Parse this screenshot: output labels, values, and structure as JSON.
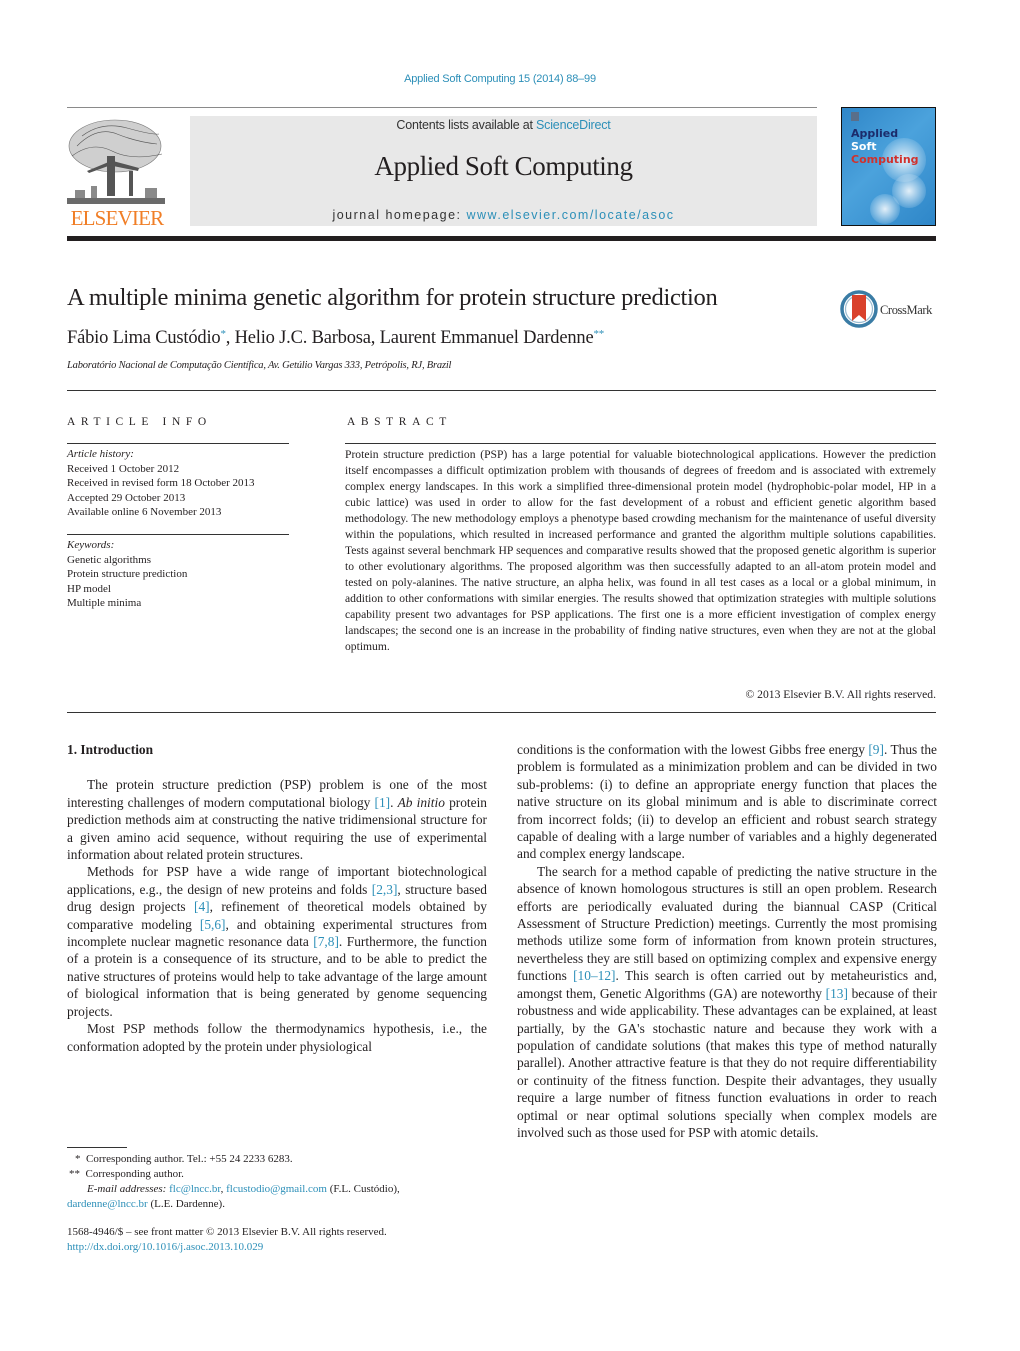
{
  "header": {
    "citation": "Applied Soft Computing 15 (2014) 88–99",
    "contents_prefix": "Contents lists available at ",
    "contents_link": "ScienceDirect",
    "journal_name": "Applied Soft Computing",
    "homepage_prefix": "journal homepage: ",
    "homepage_link": "www.elsevier.com/locate/asoc",
    "publisher_logo_text": "ELSEVIER",
    "cover": {
      "line1": "Applied",
      "line2": "Soft",
      "line3": "Computing"
    },
    "colors": {
      "link": "#2c8fb8",
      "elsevier_orange": "#f07e26",
      "banner_bg": "#e8e8e8"
    }
  },
  "article": {
    "title": "A multiple minima genetic algorithm for protein structure prediction",
    "crossmark_label": "CrossMark",
    "authors": [
      {
        "name": "Fábio Lima Custódio",
        "mark": "*"
      },
      {
        "name": "Helio J.C. Barbosa",
        "mark": ""
      },
      {
        "name": "Laurent Emmanuel Dardenne",
        "mark": "**"
      }
    ],
    "affiliation": "Laboratório Nacional de Computação Científica, Av. Getúlio Vargas 333, Petrópolis, RJ, Brazil"
  },
  "article_info": {
    "heading": "ARTICLE INFO",
    "history_label": "Article history:",
    "history": [
      "Received 1 October 2012",
      "Received in revised form 18 October 2013",
      "Accepted 29 October 2013",
      "Available online 6 November 2013"
    ],
    "keywords_label": "Keywords:",
    "keywords": [
      "Genetic algorithms",
      "Protein structure prediction",
      "HP model",
      "Multiple minima"
    ]
  },
  "abstract": {
    "heading": "ABSTRACT",
    "text": "Protein structure prediction (PSP) has a large potential for valuable biotechnological applications. However the prediction itself encompasses a difficult optimization problem with thousands of degrees of freedom and is associated with extremely complex energy landscapes. In this work a simplified three-dimensional protein model (hydrophobic-polar model, HP in a cubic lattice) was used in order to allow for the fast development of a robust and efficient genetic algorithm based methodology. The new methodology employs a phenotype based crowding mechanism for the maintenance of useful diversity within the populations, which resulted in increased performance and granted the algorithm multiple solutions capabilities. Tests against several benchmark HP sequences and comparative results showed that the proposed genetic algorithm is superior to other evolutionary algorithms. The proposed algorithm was then successfully adapted to an all-atom protein model and tested on poly-alanines. The native structure, an alpha helix, was found in all test cases as a local or a global minimum, in addition to other conformations with similar energies. The results showed that optimization strategies with multiple solutions capability present two advantages for PSP applications. The first one is a more efficient investigation of complex energy landscapes; the second one is an increase in the probability of finding native structures, even when they are not at the global optimum.",
    "copyright": "© 2013 Elsevier B.V. All rights reserved."
  },
  "body": {
    "section_heading": "1.  Introduction",
    "left_paragraphs": [
      [
        {
          "t": "The protein structure prediction (PSP) problem is one of the most interesting challenges of modern computational biology "
        },
        {
          "c": "[1]"
        },
        {
          "t": ". "
        },
        {
          "i": "Ab initio"
        },
        {
          "t": " protein prediction methods aim at constructing the native tridimensional structure for a given amino acid sequence, without requiring the use of experimental information about related protein structures."
        }
      ],
      [
        {
          "t": "Methods for PSP have a wide range of important biotechnological applications, e.g., the design of new proteins and folds "
        },
        {
          "c": "[2,3]"
        },
        {
          "t": ", structure based drug design projects "
        },
        {
          "c": "[4]"
        },
        {
          "t": ", refinement of theoretical models obtained by comparative modeling "
        },
        {
          "c": "[5,6]"
        },
        {
          "t": ", and obtaining experimental structures from incomplete nuclear magnetic resonance data "
        },
        {
          "c": "[7,8]"
        },
        {
          "t": ". Furthermore, the function of a protein is a consequence of its structure, and to be able to predict the native structures of proteins would help to take advantage of the large amount of biological information that is being generated by genome sequencing projects."
        }
      ],
      [
        {
          "t": "Most PSP methods follow the thermodynamics hypothesis, i.e., the conformation adopted by the protein under physiological"
        }
      ]
    ],
    "right_paragraphs": [
      [
        {
          "t": "conditions is the conformation with the lowest Gibbs free energy "
        },
        {
          "c": "[9]"
        },
        {
          "t": ". Thus the problem is formulated as a minimization problem and can be divided in two sub-problems: (i) to define an appropriate energy function that places the native structure on its global minimum and is able to discriminate correct from incorrect folds; (ii) to develop an efficient and robust search strategy capable of dealing with a large number of variables and a highly degenerated and complex energy landscape."
        }
      ],
      [
        {
          "t": "The search for a method capable of predicting the native structure in the absence of known homologous structures is still an open problem. Research efforts are periodically evaluated during the biannual CASP (Critical Assessment of Structure Prediction) meetings. Currently the most promising methods utilize some form of information from known protein structures, nevertheless they are still based on optimizing complex and expensive energy functions "
        },
        {
          "c": "[10–12]"
        },
        {
          "t": ". This search is often carried out by metaheuristics and, amongst them, Genetic Algorithms (GA) are noteworthy "
        },
        {
          "c": "[13]"
        },
        {
          "t": " because of their robustness and wide applicability. These advantages can be explained, at least partially, by the GA's stochastic nature and because they work with a population of candidate solutions (that makes this type of method naturally parallel). Another attractive feature is that they do not require differentiability or continuity of the fitness function. Despite their advantages, they usually require a large number of fitness function evaluations in order to reach optimal or near optimal solutions specially when complex models are involved such as those used for PSP with atomic details."
        }
      ]
    ]
  },
  "footnotes": {
    "fn1_mark": "*",
    "fn1_text": "Corresponding author. Tel.: +55 24 2233 6283.",
    "fn2_mark": "**",
    "fn2_text": "Corresponding author.",
    "email_label": "E-mail addresses:",
    "email1": "flc@lncc.br",
    "email2": "flcustodio@gmail.com",
    "email12_owner": " (F.L. Custódio),",
    "email3": "dardenne@lncc.br",
    "email3_owner": " (L.E. Dardenne).",
    "front_matter": "1568-4946/$ – see front matter © 2013 Elsevier B.V. All rights reserved.",
    "doi": "http://dx.doi.org/10.1016/j.asoc.2013.10.029"
  }
}
